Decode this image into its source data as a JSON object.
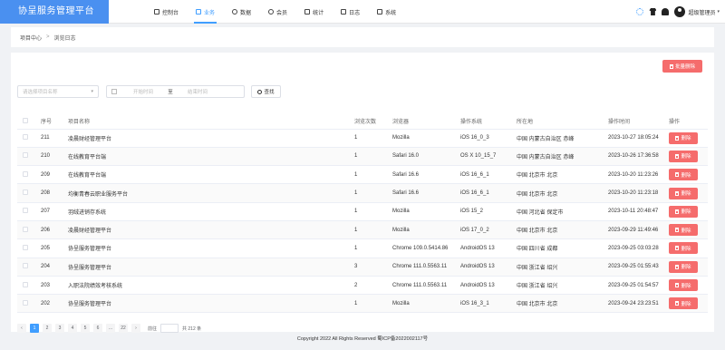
{
  "header": {
    "brand": "协呈服务管理平台",
    "nav": [
      {
        "label": "控制台",
        "icon": "monitor-icon"
      },
      {
        "label": "业务",
        "icon": "calendar-icon",
        "active": true
      },
      {
        "label": "数据",
        "icon": "globe-icon"
      },
      {
        "label": "会员",
        "icon": "user-icon"
      },
      {
        "label": "统计",
        "icon": "chat-icon"
      },
      {
        "label": "日志",
        "icon": "log-icon"
      },
      {
        "label": "系统",
        "icon": "system-icon"
      }
    ],
    "username": "超级管理员",
    "accent_color": "#409eff",
    "brand_color": "#4a90f0"
  },
  "breadcrumb": {
    "root": "项目中心",
    "separator": ">",
    "current": "浏览日志"
  },
  "toolbar": {
    "batch_delete_label": "批量删除"
  },
  "filters": {
    "project_placeholder": "请选择项目名称",
    "start_placeholder": "开始时间",
    "date_separator": "至",
    "end_placeholder": "结束时间",
    "search_label": "查找"
  },
  "table": {
    "headers": {
      "id": "序号",
      "name": "项目名称",
      "count": "浏览次数",
      "browser": "浏览器",
      "os": "操作系统",
      "location": "所在地",
      "time": "操作时间",
      "action": "操作"
    },
    "delete_label": "删除",
    "rows": [
      {
        "id": "211",
        "name": "凌晨财经管理平台",
        "count": "1",
        "browser": "Mozilla",
        "os": "iOS 16_0_3",
        "location": "中国 内蒙古自治区 赤峰",
        "time": "2023-10-27 18:05:24"
      },
      {
        "id": "210",
        "name": "在线教育平台端",
        "count": "1",
        "browser": "Safari 16.0",
        "os": "OS X 10_15_7",
        "location": "中国 内蒙古自治区 赤峰",
        "time": "2023-10-26 17:36:58"
      },
      {
        "id": "209",
        "name": "在线教育平台端",
        "count": "1",
        "browser": "Safari 16.6",
        "os": "iOS 16_6_1",
        "location": "中国 北京市 北京",
        "time": "2023-10-20 11:23:26"
      },
      {
        "id": "208",
        "name": "均衡青春云职业服务平台",
        "count": "1",
        "browser": "Safari 16.6",
        "os": "iOS 16_6_1",
        "location": "中国 北京市 北京",
        "time": "2023-10-20 11:23:18"
      },
      {
        "id": "207",
        "name": "羽绒进销存系统",
        "count": "1",
        "browser": "Mozilla",
        "os": "iOS 15_2",
        "location": "中国 河北省 保定市",
        "time": "2023-10-11 20:48:47"
      },
      {
        "id": "206",
        "name": "凌晨财经管理平台",
        "count": "1",
        "browser": "Mozilla",
        "os": "iOS 17_0_2",
        "location": "中国 北京市 北京",
        "time": "2023-09-29 11:49:46"
      },
      {
        "id": "205",
        "name": "协呈服务管理平台",
        "count": "1",
        "browser": "Chrome 109.0.5414.86",
        "os": "AndroidOS 13",
        "location": "中国 四川省 成都",
        "time": "2023-09-25 03:03:28"
      },
      {
        "id": "204",
        "name": "协呈服务管理平台",
        "count": "3",
        "browser": "Chrome 111.0.5563.11",
        "os": "AndroidOS 13",
        "location": "中国 浙江省 绍兴",
        "time": "2023-09-25 01:55:43"
      },
      {
        "id": "203",
        "name": "入职法院绩效考核系统",
        "count": "2",
        "browser": "Chrome 111.0.5563.11",
        "os": "AndroidOS 13",
        "location": "中国 浙江省 绍兴",
        "time": "2023-09-25 01:54:57"
      },
      {
        "id": "202",
        "name": "协呈服务管理平台",
        "count": "1",
        "browser": "Mozilla",
        "os": "iOS 16_3_1",
        "location": "中国 北京市 北京",
        "time": "2023-09-24 23:23:51"
      }
    ]
  },
  "pagination": {
    "prev": "‹",
    "pages": [
      "1",
      "2",
      "3",
      "4",
      "5",
      "6",
      "…",
      "22"
    ],
    "next": "›",
    "goto_label": "前往",
    "total_label": "共 212 条"
  },
  "footer": {
    "text": "Copyright 2022 All Rights Reserved 蜀ICP备2022002117号"
  }
}
